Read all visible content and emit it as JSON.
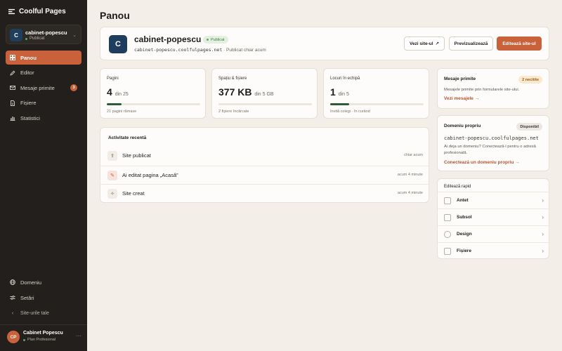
{
  "brand": {
    "name": "Coolful Pages"
  },
  "site_switcher": {
    "initial": "C",
    "name": "cabinet-popescu",
    "status": "Publicat"
  },
  "sidebar": {
    "items": [
      {
        "label": "Panou",
        "icon": "grid-icon",
        "active": true
      },
      {
        "label": "Editor",
        "icon": "pencil-icon"
      },
      {
        "label": "Mesaje primite",
        "icon": "mail-icon",
        "badge": "3"
      },
      {
        "label": "Fișiere",
        "icon": "file-icon"
      },
      {
        "label": "Statistici",
        "icon": "chart-icon"
      }
    ],
    "bottom_items": [
      {
        "label": "Domeniu",
        "icon": "globe-icon"
      },
      {
        "label": "Setări",
        "icon": "sliders-icon"
      },
      {
        "label": "Site-urile tale",
        "icon": "chevron-left-icon"
      }
    ]
  },
  "user": {
    "initials": "CP",
    "name": "Cabinet Popescu",
    "plan": "Plan Profesional"
  },
  "page": {
    "title": "Panou"
  },
  "site": {
    "initial": "C",
    "name": "cabinet-popescu",
    "status": "Publicat",
    "url": "cabinet-popescu.coolfulpages.net",
    "published_note": "· Publicat chiar acum"
  },
  "actions": {
    "view_site": "Vezi site-ul",
    "preview": "Previzualizează",
    "edit_site": "Editează site-ul"
  },
  "stats": [
    {
      "label": "Pagini",
      "value": "4",
      "suffix": "din 25",
      "progress": 0.16,
      "note": "21 pagini rămase"
    },
    {
      "label": "Spațiu & fișiere",
      "value": "377 KB",
      "suffix": "din 5 GB",
      "progress": 0.0,
      "note": "2 fișiere încărcate"
    },
    {
      "label": "Locuri în echipă",
      "value": "1",
      "suffix": "din 5",
      "progress": 0.2,
      "note": "Invită colegi · în curând"
    }
  ],
  "activity": {
    "title": "Activitate recentă",
    "items": [
      {
        "text": "Site publicat",
        "time": "chiar acum",
        "icon": "upload-icon"
      },
      {
        "text": "Ai editat pagina „Acasă”",
        "time": "acum 4 minute",
        "icon": "pencil-icon"
      },
      {
        "text": "Site creat",
        "time": "acum 4 minute",
        "icon": "sparkle-icon"
      }
    ]
  },
  "messages": {
    "title": "Mesaje primite",
    "tag": "2 necitite",
    "desc": "Mesajele primite prin formularele site-ului.",
    "link": "Vezi mesajele →"
  },
  "domain": {
    "title": "Domeniu propriu",
    "tag": "Disponibil",
    "url": "cabinet-popescu.coolfulpages.net",
    "desc": "Ai deja un domeniu? Conectează-l pentru o adresă profesională.",
    "link": "Conectează un domeniu propriu →"
  },
  "quick_edit": {
    "title": "Editează rapid",
    "items": [
      {
        "label": "Antet",
        "icon": "header-icon"
      },
      {
        "label": "Subsol",
        "icon": "footer-icon"
      },
      {
        "label": "Design",
        "icon": "palette-icon"
      },
      {
        "label": "Fișiere",
        "icon": "image-icon"
      }
    ]
  },
  "colors": {
    "accent": "#c9613a",
    "sidebar_bg": "#221f1c",
    "page_bg": "#f3efe8",
    "progress": "#2e5a3a",
    "site_avatar": "#1f3d5c"
  }
}
